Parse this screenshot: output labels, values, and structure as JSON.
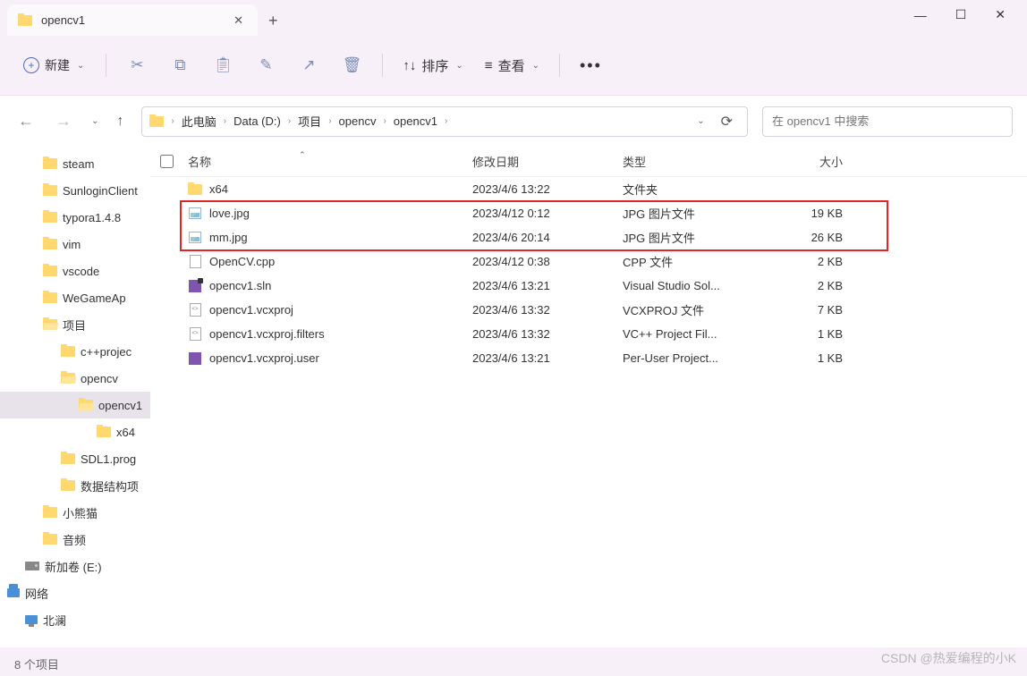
{
  "tab": {
    "title": "opencv1"
  },
  "toolbar": {
    "new_label": "新建",
    "sort_label": "排序",
    "view_label": "查看"
  },
  "breadcrumb": {
    "items": [
      "此电脑",
      "Data (D:)",
      "项目",
      "opencv",
      "opencv1"
    ]
  },
  "search": {
    "placeholder": "在 opencv1 中搜索"
  },
  "sidebar": {
    "items": [
      {
        "label": "steam",
        "indent": 0,
        "icon": "folder"
      },
      {
        "label": "SunloginClient",
        "indent": 0,
        "icon": "folder"
      },
      {
        "label": "typora1.4.8",
        "indent": 0,
        "icon": "folder"
      },
      {
        "label": "vim",
        "indent": 0,
        "icon": "folder"
      },
      {
        "label": "vscode",
        "indent": 0,
        "icon": "folder"
      },
      {
        "label": "WeGameAp",
        "indent": 0,
        "icon": "folder"
      },
      {
        "label": "项目",
        "indent": 0,
        "icon": "folder-open"
      },
      {
        "label": "c++projec",
        "indent": 1,
        "icon": "folder"
      },
      {
        "label": "opencv",
        "indent": 1,
        "icon": "folder-open"
      },
      {
        "label": "opencv1",
        "indent": 2,
        "icon": "folder-open",
        "selected": true
      },
      {
        "label": "x64",
        "indent": 3,
        "icon": "folder"
      },
      {
        "label": "SDL1.prog",
        "indent": 1,
        "icon": "folder"
      },
      {
        "label": "数据结构项",
        "indent": 1,
        "icon": "folder"
      },
      {
        "label": "小熊猫",
        "indent": 0,
        "icon": "folder"
      },
      {
        "label": "音频",
        "indent": 0,
        "icon": "folder"
      },
      {
        "label": "新加卷 (E:)",
        "indent": -1,
        "icon": "drive"
      },
      {
        "label": "网络",
        "indent": -2,
        "icon": "network"
      },
      {
        "label": "北澜",
        "indent": -1,
        "icon": "monitor"
      }
    ]
  },
  "columns": {
    "name": "名称",
    "date": "修改日期",
    "type": "类型",
    "size": "大小"
  },
  "files": [
    {
      "name": "x64",
      "date": "2023/4/6 13:22",
      "type": "文件夹",
      "size": "",
      "icon": "folder"
    },
    {
      "name": "love.jpg",
      "date": "2023/4/12 0:12",
      "type": "JPG 图片文件",
      "size": "19 KB",
      "icon": "img"
    },
    {
      "name": "mm.jpg",
      "date": "2023/4/6 20:14",
      "type": "JPG 图片文件",
      "size": "26 KB",
      "icon": "img"
    },
    {
      "name": "OpenCV.cpp",
      "date": "2023/4/12 0:38",
      "type": "CPP 文件",
      "size": "2 KB",
      "icon": "cpp"
    },
    {
      "name": "opencv1.sln",
      "date": "2023/4/6 13:21",
      "type": "Visual Studio Sol...",
      "size": "2 KB",
      "icon": "sln"
    },
    {
      "name": "opencv1.vcxproj",
      "date": "2023/4/6 13:32",
      "type": "VCXPROJ 文件",
      "size": "7 KB",
      "icon": "vcx"
    },
    {
      "name": "opencv1.vcxproj.filters",
      "date": "2023/4/6 13:32",
      "type": "VC++ Project Fil...",
      "size": "1 KB",
      "icon": "vcx"
    },
    {
      "name": "opencv1.vcxproj.user",
      "date": "2023/4/6 13:21",
      "type": "Per-User Project...",
      "size": "1 KB",
      "icon": "usr"
    }
  ],
  "status": "8 个项目",
  "watermark": "CSDN @热爱编程的小K"
}
